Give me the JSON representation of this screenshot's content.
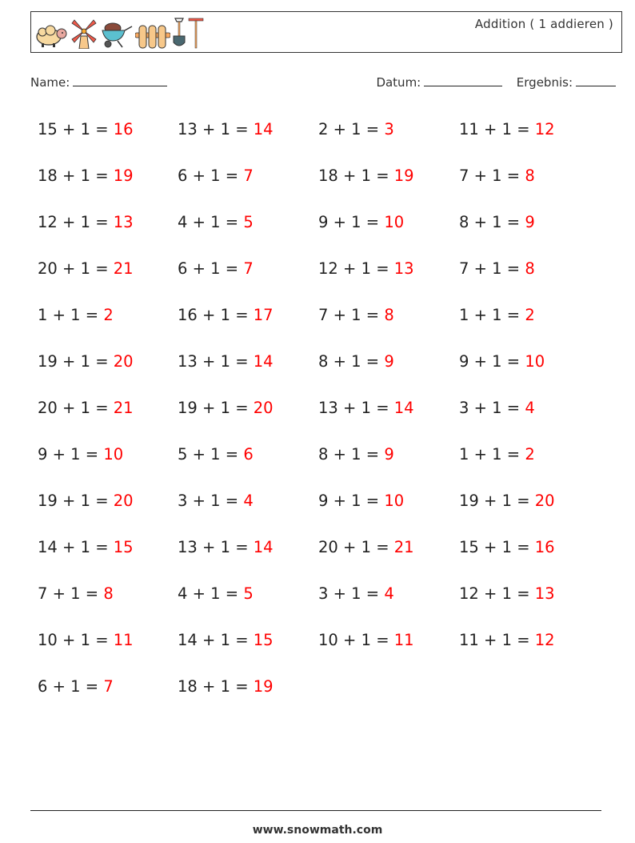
{
  "header": {
    "title": "Addition ( 1 addieren )",
    "icons": [
      "sheep-icon",
      "windmill-icon",
      "wheelbarrow-icon",
      "fence-icon",
      "shovel-icon",
      "rake-icon"
    ]
  },
  "fields": {
    "name_label": "Name:",
    "date_label": "Datum:",
    "result_label": "Ergebnis:"
  },
  "colors": {
    "answer": "#ff0000",
    "text": "#222222"
  },
  "problems": [
    {
      "a": "15",
      "b": "1",
      "answer": "16"
    },
    {
      "a": "13",
      "b": "1",
      "answer": "14"
    },
    {
      "a": "2",
      "b": "1",
      "answer": "3"
    },
    {
      "a": "11",
      "b": "1",
      "answer": "12"
    },
    {
      "a": "18",
      "b": "1",
      "answer": "19"
    },
    {
      "a": "6",
      "b": "1",
      "answer": "7"
    },
    {
      "a": "18",
      "b": "1",
      "answer": "19"
    },
    {
      "a": "7",
      "b": "1",
      "answer": "8"
    },
    {
      "a": "12",
      "b": "1",
      "answer": "13"
    },
    {
      "a": "4",
      "b": "1",
      "answer": "5"
    },
    {
      "a": "9",
      "b": "1",
      "answer": "10"
    },
    {
      "a": "8",
      "b": "1",
      "answer": "9"
    },
    {
      "a": "20",
      "b": "1",
      "answer": "21"
    },
    {
      "a": "6",
      "b": "1",
      "answer": "7"
    },
    {
      "a": "12",
      "b": "1",
      "answer": "13"
    },
    {
      "a": "7",
      "b": "1",
      "answer": "8"
    },
    {
      "a": "1",
      "b": "1",
      "answer": "2"
    },
    {
      "a": "16",
      "b": "1",
      "answer": "17"
    },
    {
      "a": "7",
      "b": "1",
      "answer": "8"
    },
    {
      "a": "1",
      "b": "1",
      "answer": "2"
    },
    {
      "a": "19",
      "b": "1",
      "answer": "20"
    },
    {
      "a": "13",
      "b": "1",
      "answer": "14"
    },
    {
      "a": "8",
      "b": "1",
      "answer": "9"
    },
    {
      "a": "9",
      "b": "1",
      "answer": "10"
    },
    {
      "a": "20",
      "b": "1",
      "answer": "21"
    },
    {
      "a": "19",
      "b": "1",
      "answer": "20"
    },
    {
      "a": "13",
      "b": "1",
      "answer": "14"
    },
    {
      "a": "3",
      "b": "1",
      "answer": "4"
    },
    {
      "a": "9",
      "b": "1",
      "answer": "10"
    },
    {
      "a": "5",
      "b": "1",
      "answer": "6"
    },
    {
      "a": "8",
      "b": "1",
      "answer": "9"
    },
    {
      "a": "1",
      "b": "1",
      "answer": "2"
    },
    {
      "a": "19",
      "b": "1",
      "answer": "20"
    },
    {
      "a": "3",
      "b": "1",
      "answer": "4"
    },
    {
      "a": "9",
      "b": "1",
      "answer": "10"
    },
    {
      "a": "19",
      "b": "1",
      "answer": "20"
    },
    {
      "a": "14",
      "b": "1",
      "answer": "15"
    },
    {
      "a": "13",
      "b": "1",
      "answer": "14"
    },
    {
      "a": "20",
      "b": "1",
      "answer": "21"
    },
    {
      "a": "15",
      "b": "1",
      "answer": "16"
    },
    {
      "a": "7",
      "b": "1",
      "answer": "8"
    },
    {
      "a": "4",
      "b": "1",
      "answer": "5"
    },
    {
      "a": "3",
      "b": "1",
      "answer": "4"
    },
    {
      "a": "12",
      "b": "1",
      "answer": "13"
    },
    {
      "a": "10",
      "b": "1",
      "answer": "11"
    },
    {
      "a": "14",
      "b": "1",
      "answer": "15"
    },
    {
      "a": "10",
      "b": "1",
      "answer": "11"
    },
    {
      "a": "11",
      "b": "1",
      "answer": "12"
    },
    {
      "a": "6",
      "b": "1",
      "answer": "7"
    },
    {
      "a": "18",
      "b": "1",
      "answer": "19"
    }
  ],
  "operator": "+",
  "equals": "=",
  "footer": {
    "url": "www.snowmath.com"
  }
}
